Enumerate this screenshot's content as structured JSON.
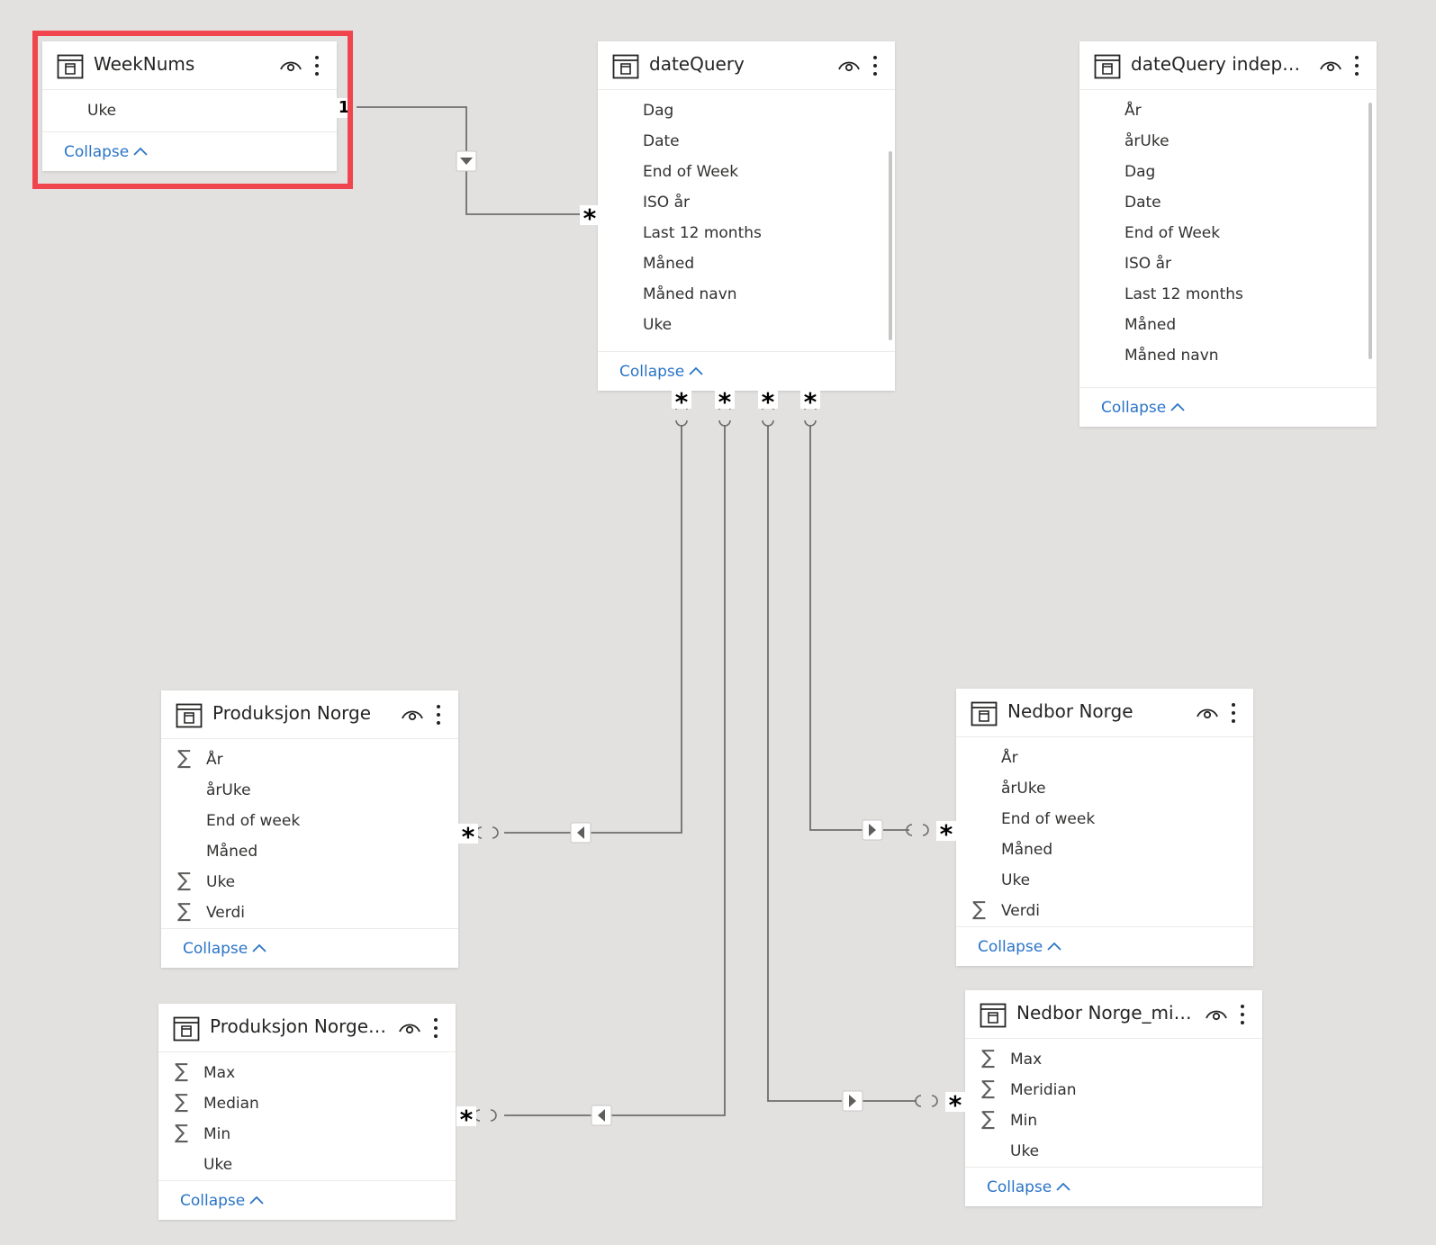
{
  "collapse_label": "Collapse",
  "relationship_one_label": "1",
  "relationship_many_label": "*",
  "colors": {
    "background": "#e2e1e0",
    "card": "#ffffff",
    "link": "#2a74c6",
    "highlight": "#f0454e",
    "connector": "#6f6e6d"
  },
  "icons": {
    "table": "table-icon",
    "visibility": "eye-icon",
    "more": "more-vertical-icon",
    "measure": "sigma-icon",
    "collapse": "chevron-up-icon"
  },
  "tables": [
    {
      "id": "weeknums",
      "title": "WeekNums",
      "fields": [
        {
          "name": "Uke",
          "sigma": false
        }
      ]
    },
    {
      "id": "datequery",
      "title": "dateQuery",
      "fields": [
        {
          "name": "Dag",
          "sigma": false
        },
        {
          "name": "Date",
          "sigma": false
        },
        {
          "name": "End of Week",
          "sigma": false
        },
        {
          "name": "ISO år",
          "sigma": false
        },
        {
          "name": "Last 12 months",
          "sigma": false
        },
        {
          "name": "Måned",
          "sigma": false
        },
        {
          "name": "Måned navn",
          "sigma": false
        },
        {
          "name": "Uke",
          "sigma": false
        }
      ]
    },
    {
      "id": "datequery-independent",
      "title": "dateQuery independ...",
      "fields": [
        {
          "name": "År",
          "sigma": false
        },
        {
          "name": "årUke",
          "sigma": false
        },
        {
          "name": "Dag",
          "sigma": false
        },
        {
          "name": "Date",
          "sigma": false
        },
        {
          "name": "End of Week",
          "sigma": false
        },
        {
          "name": "ISO år",
          "sigma": false
        },
        {
          "name": "Last 12 months",
          "sigma": false
        },
        {
          "name": "Måned",
          "sigma": false
        },
        {
          "name": "Måned navn",
          "sigma": false
        }
      ]
    },
    {
      "id": "produksjon-norge",
      "title": "Produksjon Norge",
      "fields": [
        {
          "name": "År",
          "sigma": true
        },
        {
          "name": "årUke",
          "sigma": false
        },
        {
          "name": "End of week",
          "sigma": false
        },
        {
          "name": "Måned",
          "sigma": false
        },
        {
          "name": "Uke",
          "sigma": true
        },
        {
          "name": "Verdi",
          "sigma": true
        }
      ]
    },
    {
      "id": "produksjon-norge-minmax",
      "title": "Produksjon Norge_mi...",
      "fields": [
        {
          "name": "Max",
          "sigma": true
        },
        {
          "name": "Median",
          "sigma": true
        },
        {
          "name": "Min",
          "sigma": true
        },
        {
          "name": "Uke",
          "sigma": false
        }
      ]
    },
    {
      "id": "nedbor-norge",
      "title": "Nedbor Norge",
      "fields": [
        {
          "name": "År",
          "sigma": false
        },
        {
          "name": "årUke",
          "sigma": false
        },
        {
          "name": "End of week",
          "sigma": false
        },
        {
          "name": "Måned",
          "sigma": false
        },
        {
          "name": "Uke",
          "sigma": false
        },
        {
          "name": "Verdi",
          "sigma": true
        }
      ]
    },
    {
      "id": "nedbor-norge-minmax",
      "title": "Nedbor Norge_minmax",
      "fields": [
        {
          "name": "Max",
          "sigma": true
        },
        {
          "name": "Meridian",
          "sigma": true
        },
        {
          "name": "Min",
          "sigma": true
        },
        {
          "name": "Uke",
          "sigma": false
        }
      ]
    }
  ]
}
